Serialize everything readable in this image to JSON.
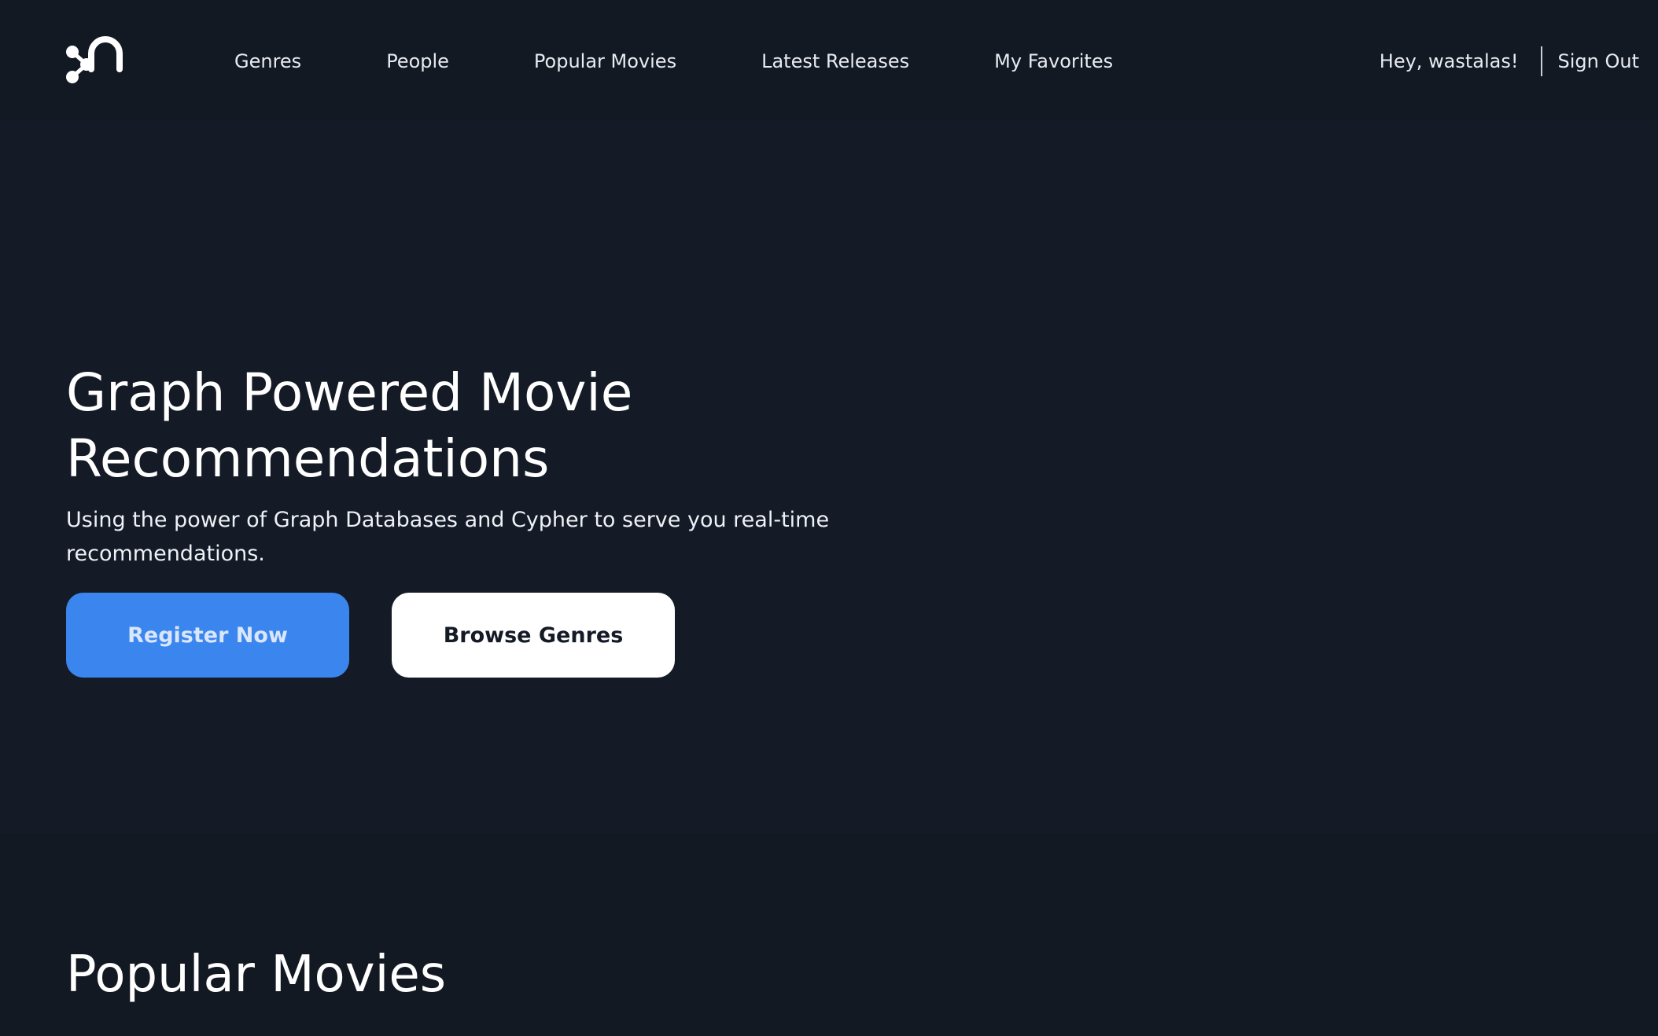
{
  "nav": {
    "items": [
      {
        "label": "Genres"
      },
      {
        "label": "People"
      },
      {
        "label": "Popular Movies"
      },
      {
        "label": "Latest Releases"
      },
      {
        "label": "My Favorites"
      }
    ]
  },
  "user": {
    "greeting": "Hey, wastalas!",
    "sign_out": "Sign Out"
  },
  "hero": {
    "title": "Graph Powered Movie Recommendations",
    "subtitle": "Using the power of Graph Databases and Cypher to serve you real-time recommendations.",
    "primary_button": "Register Now",
    "secondary_button": "Browse Genres"
  },
  "section": {
    "title": "Popular Movies"
  },
  "colors": {
    "background": "#131923",
    "primary": "#3a86ee",
    "text": "#ffffff"
  },
  "icons": {
    "logo": "graph-node-logo-icon"
  }
}
